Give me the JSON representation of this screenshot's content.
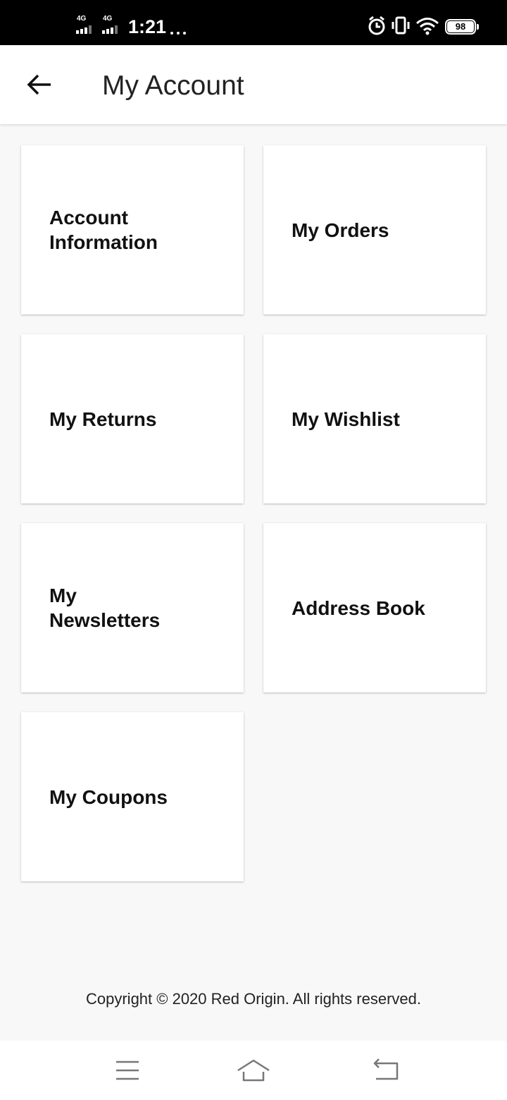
{
  "status_bar": {
    "network_1": "4G",
    "network_2": "4G",
    "time": "1:21",
    "battery": "98",
    "icons": [
      "signal-icon",
      "signal-icon",
      "more-dots-icon",
      "alarm-icon",
      "vibrate-icon",
      "wifi-icon",
      "battery-icon"
    ]
  },
  "header": {
    "back_icon": "arrow-left-icon",
    "title": "My Account"
  },
  "tiles": [
    {
      "label": "Account Information"
    },
    {
      "label": "My Orders"
    },
    {
      "label": "My Returns"
    },
    {
      "label": "My Wishlist"
    },
    {
      "label": "My Newsletters"
    },
    {
      "label": "Address Book"
    },
    {
      "label": "My Coupons"
    }
  ],
  "footer": {
    "copyright": "Copyright © 2020 Red Origin. All rights reserved."
  },
  "nav_bar": {
    "icons": [
      "menu-icon",
      "home-icon",
      "back-icon"
    ]
  },
  "colors": {
    "status_bar": "#000000",
    "background": "#f8f8f8",
    "card": "#ffffff",
    "text": "#111111"
  }
}
